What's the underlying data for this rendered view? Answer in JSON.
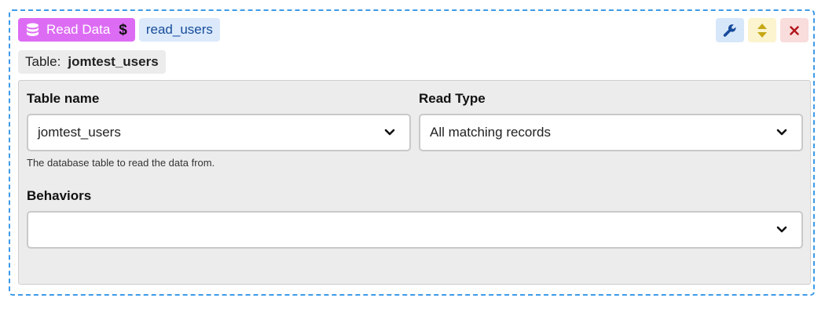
{
  "block": {
    "type_label": "Read Data",
    "type_icon": "database-icon",
    "type_suffix_icon": "dollar-icon",
    "name": "read_users",
    "colors": {
      "border": "#3d9be9",
      "type_badge": "#dd6cf4",
      "name_badge": "#dbe9fb"
    }
  },
  "actions": {
    "edit_icon": "wrench-icon",
    "move_icon": "up-down-arrows-icon",
    "delete_icon": "close-icon"
  },
  "summary": {
    "label": "Table:",
    "value": "jomtest_users"
  },
  "form": {
    "table_name": {
      "label": "Table name",
      "value": "jomtest_users",
      "help": "The database table to read the data from."
    },
    "read_type": {
      "label": "Read Type",
      "value": "All matching records"
    },
    "behaviors": {
      "label": "Behaviors",
      "value": ""
    }
  }
}
